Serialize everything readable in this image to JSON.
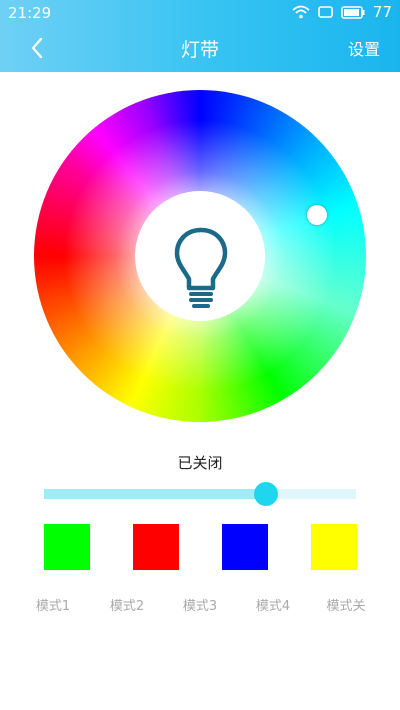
{
  "status_bar": {
    "time": "21:29",
    "battery": "77"
  },
  "header": {
    "title": "灯带",
    "settings_label": "设置"
  },
  "light": {
    "state_text": "已关闭",
    "brightness": 0.71
  },
  "modes": [
    {
      "label": "模式1",
      "color": "#00ff00"
    },
    {
      "label": "模式2",
      "color": "#ff0000"
    },
    {
      "label": "模式3",
      "color": "#0000ff"
    },
    {
      "label": "模式4",
      "color": "#ffff00"
    },
    {
      "label": "模式关"
    }
  ],
  "colors": {
    "header_gradient_start": "#6fd0f5",
    "header_gradient_end": "#1ab5ee",
    "slider_thumb": "#1fd6ee",
    "bulb_icon": "#1b6a87"
  }
}
